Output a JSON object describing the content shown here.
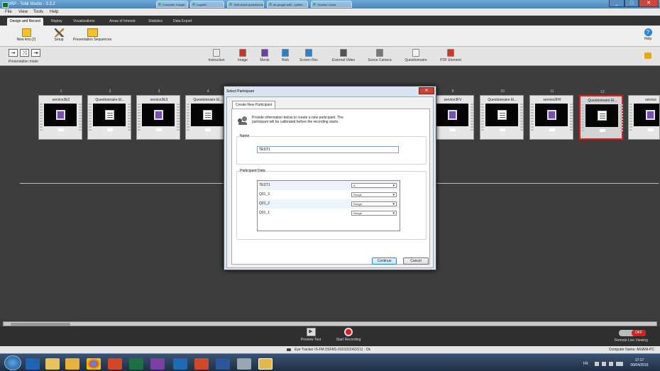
{
  "window": {
    "title": "IRP - Tobii Studio - 3.3.2",
    "browser_tabs": [
      "Computer Google",
      "Logiciel",
      "Tobii studio questionnaire",
      "de google tobii - Lyfhan",
      "Youtube Canal"
    ],
    "controls": [
      "_",
      "□",
      "✕"
    ]
  },
  "menu": {
    "items": [
      "File",
      "View",
      "Tools",
      "Help"
    ]
  },
  "tabs": {
    "items": [
      "Design and Record",
      "Replay",
      "Visualizations",
      "Areas of Interest",
      "Statistics",
      "Data Export"
    ],
    "active": "Design and Record"
  },
  "toolbar": {
    "new_test": "New test (2)",
    "setup": "Setup",
    "presentation_sequences": "Presentation Sequences",
    "help": "Help"
  },
  "presentation_mode": {
    "label": "Presentation mode"
  },
  "media": {
    "items": [
      {
        "label": "Instruction",
        "icon": "instruction-icon",
        "color": "#e8e8ea"
      },
      {
        "label": "Image",
        "icon": "image-icon",
        "color": "#c0392b"
      },
      {
        "label": "Movie",
        "icon": "movie-icon",
        "color": "#6b3fa6"
      },
      {
        "label": "Web",
        "icon": "globe-icon",
        "color": "#2a7fc9"
      },
      {
        "label": "Screen Rec",
        "icon": "screen-rec-icon",
        "color": "#2f7fd1"
      },
      {
        "label": "External Video",
        "icon": "external-video-icon",
        "color": "#555555"
      },
      {
        "label": "Scene Camera",
        "icon": "scene-camera-icon",
        "color": "#777777"
      },
      {
        "label": "Questionnaire",
        "icon": "questionnaire-icon",
        "color": "#f4f4f4"
      },
      {
        "label": "PDF Element",
        "icon": "pdf-icon",
        "color": "#d0352a"
      }
    ]
  },
  "timeline": {
    "cards": [
      {
        "num": "1",
        "label": "service3E2",
        "type": "movie"
      },
      {
        "num": "2",
        "label": "Questionnaire El...",
        "type": "questionnaire"
      },
      {
        "num": "3",
        "label": "service3E3",
        "type": "movie"
      },
      {
        "num": "4",
        "label": "Questionnaire El...",
        "type": "questionnaire"
      },
      {
        "num": "9",
        "label": "service3FV",
        "type": "movie"
      },
      {
        "num": "10",
        "label": "Questionnaire El...",
        "type": "questionnaire"
      },
      {
        "num": "11",
        "label": "service3FR",
        "type": "movie"
      },
      {
        "num": "12",
        "label": "Questionnaire El...",
        "type": "questionnaire",
        "selected": true
      },
      {
        "num": "13",
        "label": "service",
        "type": "movie"
      }
    ]
  },
  "dialog": {
    "title": "Select Participant",
    "close": "✕",
    "tab": "Create New Participant",
    "info_line1": "Provide information below to create a new participant. The",
    "info_line2": "participant will be calibrated before the recording starts.",
    "name_group": "Name",
    "name_value": "TEST1",
    "data_group": "Participant Data",
    "rows": [
      {
        "label": "TEST1",
        "value": "A"
      },
      {
        "label": "Q01_3",
        "value": "Rouge"
      },
      {
        "label": "Q01_2",
        "value": "Rouge"
      },
      {
        "label": "Q01_1",
        "value": "Rouge"
      }
    ],
    "continue": "Continue",
    "cancel": "Cancel"
  },
  "bottom": {
    "preview": "Preview Test",
    "record": "Start Recording",
    "remote_toggle": "OFF",
    "remote_label": "Remote Live Viewing",
    "tracker_status": "Eye Tracker IS-FM (ISFM1-010102242221) - Ok",
    "computer_name": "Computer Name: AKIANI-PC"
  },
  "taskbar": {
    "time": "17:17",
    "date": "06/04/2016",
    "lang": "FR"
  }
}
